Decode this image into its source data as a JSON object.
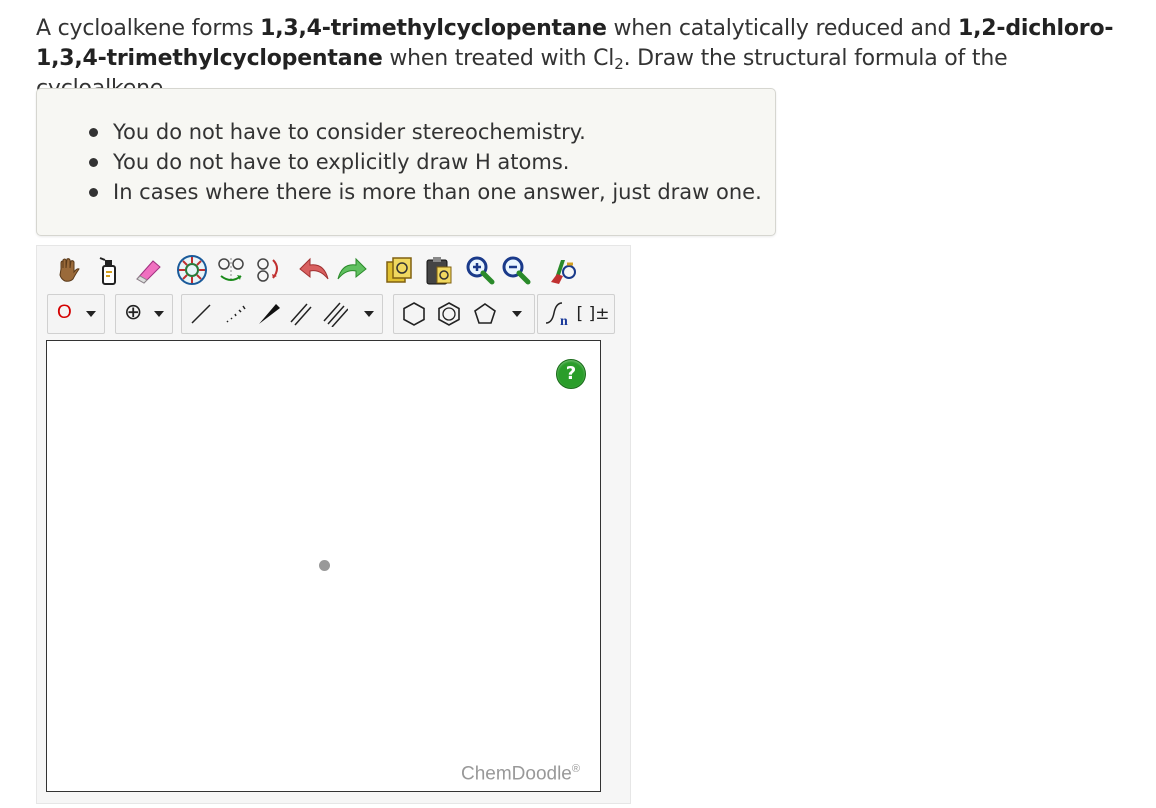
{
  "question": {
    "part1": "A cycloalkene forms ",
    "compound1": "1,3,4-trimethylcyclopentane",
    "part2": " when catalytically reduced and ",
    "compound2": "1,2-dichloro-1,3,4-trimethylcyclopentane",
    "part3": " when treated with Cl",
    "subscript": "2",
    "part4": ". Draw the structural formula of the cycloalkene."
  },
  "notes": [
    "You do not have to consider stereochemistry.",
    "You do not have to explicitly draw H atoms.",
    "In cases where there is more than one answer, just draw one."
  ],
  "editor": {
    "element_label": "O",
    "charge_label": "⊕",
    "sgroup_label": "n",
    "bracket_label": "[ ]±",
    "help_label": "?",
    "brand": "ChemDoodle",
    "brand_mark": "®"
  },
  "colors": {
    "element": "#d40000",
    "help": "#2a9d2a"
  },
  "icons": [
    "hand-icon",
    "spray-bottle-icon",
    "eraser-icon",
    "center-icon",
    "flip-icon",
    "rotate-icon",
    "undo-icon",
    "redo-icon",
    "copy-icon",
    "paste-icon",
    "zoom-in-icon",
    "zoom-out-icon",
    "clean-icon"
  ]
}
